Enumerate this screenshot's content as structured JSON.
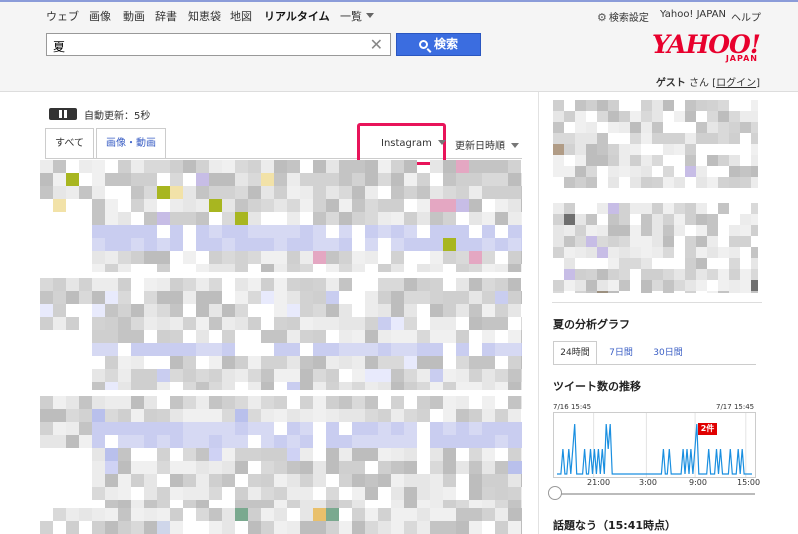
{
  "nav": {
    "items": [
      {
        "label": "ウェブ"
      },
      {
        "label": "画像"
      },
      {
        "label": "動画"
      },
      {
        "label": "辞書"
      },
      {
        "label": "知恵袋"
      },
      {
        "label": "地図"
      },
      {
        "label": "リアルタイム",
        "active": true
      },
      {
        "label": "一覧"
      }
    ]
  },
  "header_links": {
    "settings": "検索設定",
    "yahoo_japan": "Yahoo! JAPAN",
    "help": "ヘルプ"
  },
  "search": {
    "value": "夏",
    "button_label": "検索"
  },
  "logo": {
    "main": "YAHOO!",
    "sub": "JAPAN"
  },
  "user": {
    "name": "ゲスト",
    "honorific": "さん",
    "login_label": "ログイン"
  },
  "timeline": {
    "auto_update": "自動更新：5秒",
    "tabs": [
      {
        "label": "すべて",
        "selected": true
      },
      {
        "label": "画像・動画",
        "selected": false
      }
    ],
    "filter": "Instagram",
    "sort": "更新日時順"
  },
  "analysis": {
    "title": "夏の分析グラフ",
    "range_tabs": [
      {
        "label": "24時間",
        "selected": true
      },
      {
        "label": "7日間",
        "selected": false
      },
      {
        "label": "30日間",
        "selected": false
      }
    ],
    "trend_title": "ツイート数の推移",
    "range_start": "7/16 15:45",
    "range_end": "7/17 15:45",
    "peak_label": "2件",
    "x_ticks": [
      "21:00",
      "3:00",
      "9:00",
      "15:00"
    ]
  },
  "trending": {
    "title": "話題なう（15:41時点）"
  },
  "colors": {
    "accent_blue": "#3b6de0",
    "brand_red": "#e8002d",
    "highlight_pink": "#e8145a",
    "chart_line": "#1a8fe0"
  },
  "chart_data": {
    "type": "line",
    "title": "ツイート数の推移",
    "x_range": [
      "7/16 15:45",
      "7/17 15:45"
    ],
    "x_ticks": [
      "21:00",
      "3:00",
      "9:00",
      "15:00"
    ],
    "peak_value": 2,
    "peak_label": "2件",
    "series": [
      {
        "values": [
          0,
          0,
          0,
          1,
          0,
          0,
          1,
          0,
          1,
          2,
          0,
          0,
          0,
          0,
          1,
          0,
          0,
          1,
          0,
          1,
          0,
          1,
          0,
          1,
          0,
          2,
          1,
          2,
          0,
          0,
          0,
          0,
          0,
          0,
          0,
          0,
          0,
          0,
          0,
          0,
          0,
          0,
          0,
          0,
          0,
          0,
          0,
          0,
          0,
          0,
          0,
          0,
          0,
          0,
          1,
          0,
          0,
          1,
          0,
          0,
          0,
          0,
          0,
          0,
          1,
          0,
          1,
          0,
          1,
          0,
          1,
          2,
          0,
          0,
          0,
          0,
          0,
          1,
          0,
          0,
          0,
          1,
          0,
          1,
          0,
          0,
          0,
          0,
          1,
          0,
          0,
          0,
          1,
          0,
          1,
          0,
          0,
          0,
          0,
          0
        ]
      }
    ],
    "grid": true
  }
}
